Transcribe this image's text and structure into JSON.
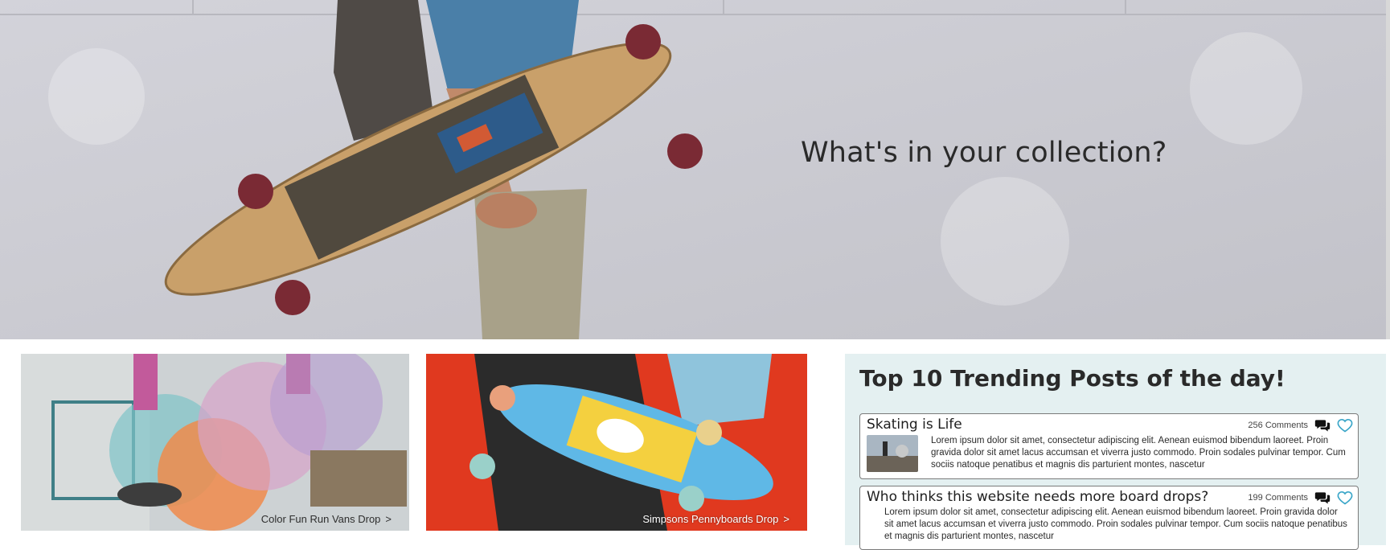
{
  "hero": {
    "title": "What's in your collection?"
  },
  "promos": [
    {
      "caption": "Color Fun Run Vans Drop",
      "arrow": ">"
    },
    {
      "caption": "Simpsons Pennyboards Drop",
      "arrow": ">"
    }
  ],
  "trending": {
    "title": "Top 10 Trending Posts of the day!",
    "posts": [
      {
        "title": "Skating is Life",
        "comments": "256 Comments",
        "body": "Lorem ipsum dolor sit amet, consectetur adipiscing elit. Aenean euismod bibendum laoreet. Proin gravida dolor sit amet lacus accumsan et viverra justo commodo. Proin sodales pulvinar tempor. Cum sociis natoque penatibus et magnis dis parturient montes, nascetur"
      },
      {
        "title": "Who thinks this website needs more board drops?",
        "comments": "199 Comments",
        "body": "Lorem ipsum dolor sit amet, consectetur adipiscing elit. Aenean euismod bibendum laoreet. Proin gravida dolor sit amet lacus accumsan et viverra justo commodo. Proin sodales pulvinar tempor. Cum sociis natoque penatibus et magnis dis parturient montes, nascetur"
      }
    ]
  },
  "colors": {
    "accent_heart": "#3aa6c8",
    "panel_bg": "#e4f0f1",
    "promo_red": "#e23a20"
  },
  "icons": {
    "comment": "comment-bubbles-icon",
    "heart": "heart-outline-icon"
  }
}
